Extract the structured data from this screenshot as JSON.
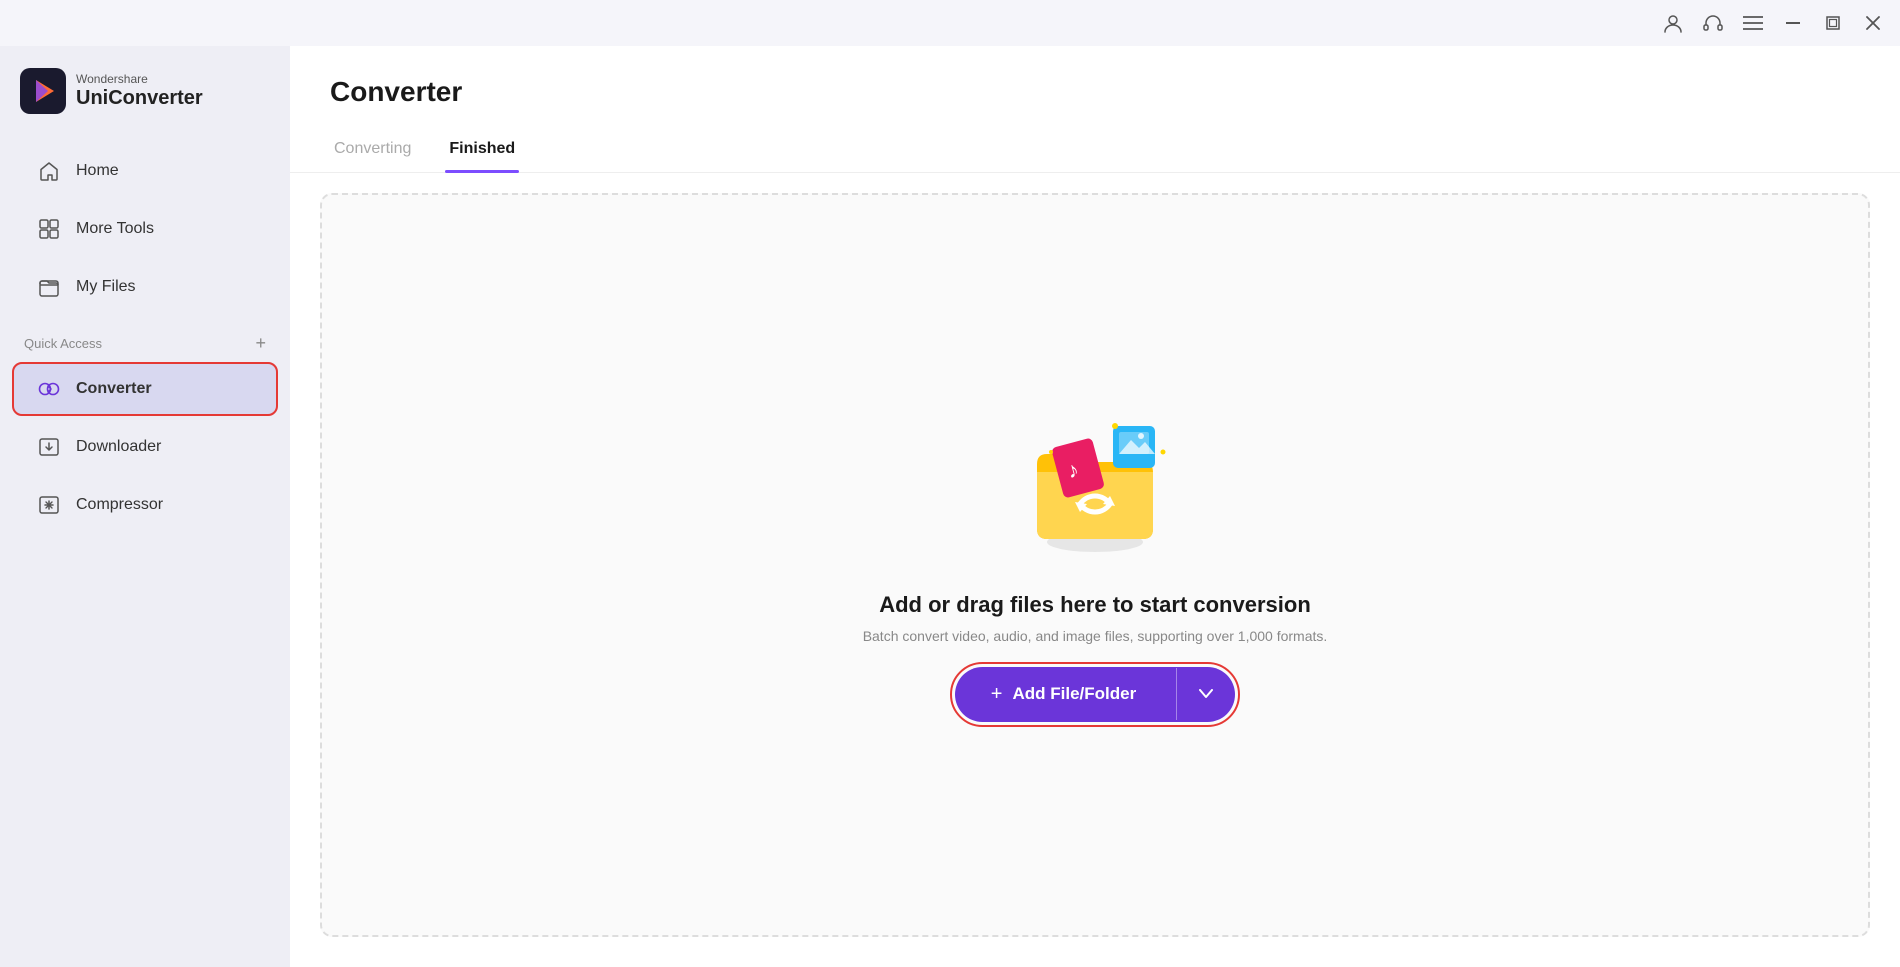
{
  "titlebar": {
    "icons": [
      {
        "name": "user-icon",
        "symbol": "👤"
      },
      {
        "name": "headset-icon",
        "symbol": "🎧"
      },
      {
        "name": "menu-icon",
        "symbol": "☰"
      },
      {
        "name": "minimize-icon",
        "symbol": "—"
      },
      {
        "name": "maximize-icon",
        "symbol": "⛶"
      },
      {
        "name": "close-icon",
        "symbol": "✕"
      }
    ]
  },
  "sidebar": {
    "logo": {
      "brand_top": "Wondershare",
      "brand_bottom": "UniConverter"
    },
    "nav_items": [
      {
        "id": "home",
        "label": "Home",
        "active": false
      },
      {
        "id": "more-tools",
        "label": "More Tools",
        "active": false
      },
      {
        "id": "my-files",
        "label": "My Files",
        "active": false
      }
    ],
    "quick_access_label": "Quick Access",
    "quick_access_items": [
      {
        "id": "converter",
        "label": "Converter",
        "active": true
      },
      {
        "id": "downloader",
        "label": "Downloader",
        "active": false
      },
      {
        "id": "compressor",
        "label": "Compressor",
        "active": false
      }
    ]
  },
  "main": {
    "page_title": "Converter",
    "tabs": [
      {
        "id": "converting",
        "label": "Converting",
        "active": false
      },
      {
        "id": "finished",
        "label": "Finished",
        "active": true
      }
    ],
    "drop_area": {
      "title": "Add or drag files here to start conversion",
      "subtitle": "Batch convert video, audio, and image files, supporting over 1,000 formats.",
      "add_button_label": "Add File/Folder",
      "add_button_prefix": "+"
    }
  },
  "colors": {
    "accent_purple": "#6b35d9",
    "active_nav_bg": "#d8d8f0",
    "sidebar_bg": "#eeeef5",
    "tab_underline": "#7c4dff",
    "red_outline": "#e53935"
  }
}
